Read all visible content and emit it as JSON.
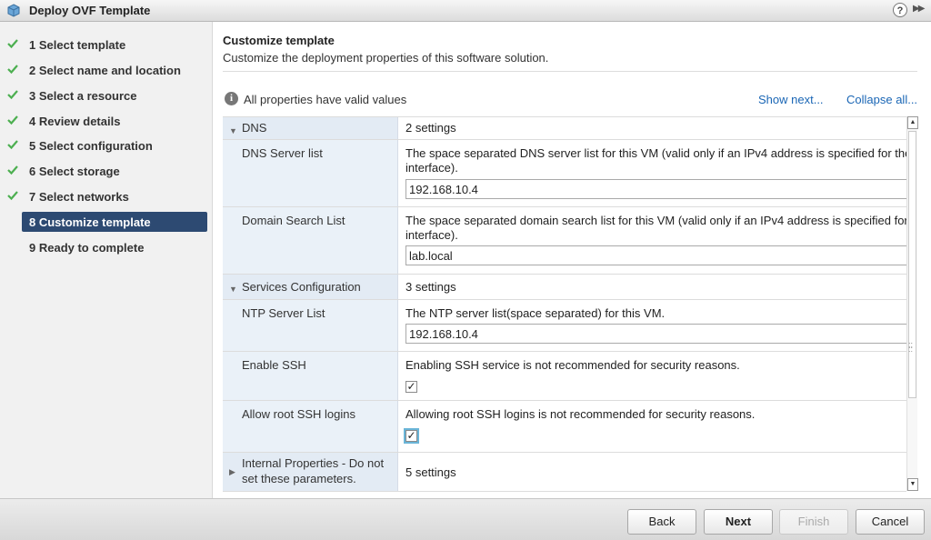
{
  "window": {
    "title": "Deploy OVF Template",
    "help_glyph": "?",
    "expand_glyph": "▶▶"
  },
  "steps": [
    {
      "label": "1  Select template",
      "done": true
    },
    {
      "label": "2  Select name and location",
      "done": true
    },
    {
      "label": "3  Select a resource",
      "done": true
    },
    {
      "label": "4  Review details",
      "done": true
    },
    {
      "label": "5  Select configuration",
      "done": true
    },
    {
      "label": "6  Select storage",
      "done": true
    },
    {
      "label": "7  Select networks",
      "done": true
    },
    {
      "label": "8  Customize template",
      "active": true
    },
    {
      "label": "9  Ready to complete"
    }
  ],
  "main": {
    "title": "Customize template",
    "subtitle": "Customize the deployment properties of this software solution.",
    "validity": "All properties have valid values",
    "show_next": "Show next...",
    "collapse_all": "Collapse all..."
  },
  "properties": {
    "dns_group": {
      "name": "DNS",
      "count": "2 settings"
    },
    "dns_server": {
      "name": "DNS Server list",
      "desc1": "The space separated DNS server list for this VM (valid only if an IPv4 address is specified for the",
      "desc2": "interface).",
      "value": "192.168.10.4"
    },
    "domain_search": {
      "name": "Domain Search List",
      "desc1": "The space separated domain search list for this VM (valid only if an IPv4 address is specified for",
      "desc2": "interface).",
      "value": "lab.local"
    },
    "services_group": {
      "name": "Services Configuration",
      "count": "3 settings"
    },
    "ntp": {
      "name": "NTP Server List",
      "desc": "The NTP server list(space separated) for this VM.",
      "value": "192.168.10.4"
    },
    "ssh": {
      "name": "Enable SSH",
      "desc": "Enabling SSH service is not recommended for security reasons.",
      "checked": "✓"
    },
    "root_ssh": {
      "name": "Allow root SSH logins",
      "desc": "Allowing root SSH logins is not recommended for security reasons.",
      "checked": "✓"
    },
    "internal_group": {
      "name1": "Internal Properties - Do not",
      "name2": "set these parameters.",
      "count": "5 settings"
    }
  },
  "buttons": {
    "back": "Back",
    "next": "Next",
    "finish": "Finish",
    "cancel": "Cancel"
  },
  "colors": {
    "accent": "#2d4a72",
    "link": "#1a66b5",
    "check": "#4caf50"
  }
}
